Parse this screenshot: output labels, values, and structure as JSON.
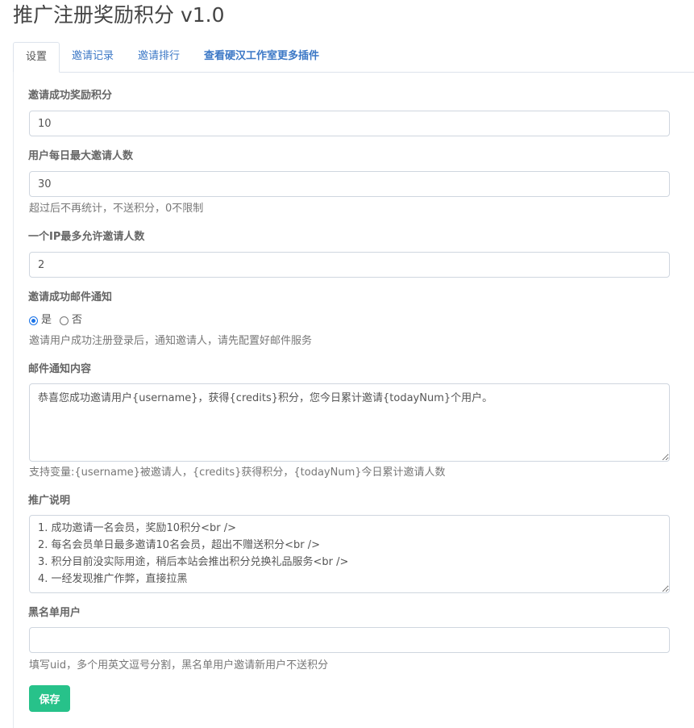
{
  "header": {
    "title": "推广注册奖励积分 v1.0"
  },
  "tabs": [
    {
      "label": "设置"
    },
    {
      "label": "邀请记录"
    },
    {
      "label": "邀请排行"
    },
    {
      "label": "查看硬汉工作室更多插件"
    }
  ],
  "form": {
    "reward_credits": {
      "label": "邀请成功奖励积分",
      "value": "10"
    },
    "daily_max": {
      "label": "用户每日最大邀请人数",
      "value": "30",
      "help": "超过后不再统计，不送积分，0不限制"
    },
    "ip_max": {
      "label": "一个IP最多允许邀请人数",
      "value": "2"
    },
    "email_notify": {
      "label": "邀请成功邮件通知",
      "options": [
        "是",
        "否"
      ],
      "selected": "是",
      "help": "邀请用户成功注册登录后，通知邀请人，请先配置好邮件服务"
    },
    "email_content": {
      "label": "邮件通知内容",
      "value": "恭喜您成功邀请用户{username}，获得{credits}积分，您今日累计邀请{todayNum}个用户。",
      "help": "支持变量:{username}被邀请人，{credits}获得积分，{todayNum}今日累计邀请人数"
    },
    "promo_desc": {
      "label": "推广说明",
      "value": "1. 成功邀请一名会员，奖励10积分<br />\n2. 每名会员单日最多邀请10名会员，超出不赠送积分<br />\n3. 积分目前没实际用途，稍后本站会推出积分兑换礼品服务<br />\n4. 一经发现推广作弊，直接拉黑"
    },
    "blacklist": {
      "label": "黑名单用户",
      "value": "",
      "help": "填写uid，多个用英文逗号分割，黑名单用户邀请新用户不送积分"
    },
    "save_label": "保存"
  }
}
